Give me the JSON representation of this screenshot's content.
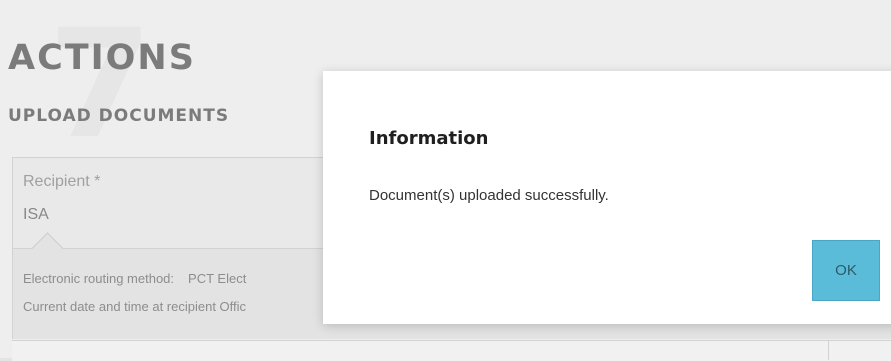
{
  "page": {
    "title": "ACTIONS",
    "section_title": "UPLOAD DOCUMENTS",
    "recipient": {
      "label": "Recipient *",
      "value": "ISA"
    },
    "routing": {
      "method_label": "Electronic routing method:",
      "method_value": "PCT Elect",
      "datetime_label": "Current date and time at recipient Offic"
    }
  },
  "dialog": {
    "title": "Information",
    "message": "Document(s) uploaded successfully.",
    "ok_label": "OK"
  },
  "colors": {
    "accent": "#5bbcd9",
    "overlay": "#e3e3e3"
  }
}
